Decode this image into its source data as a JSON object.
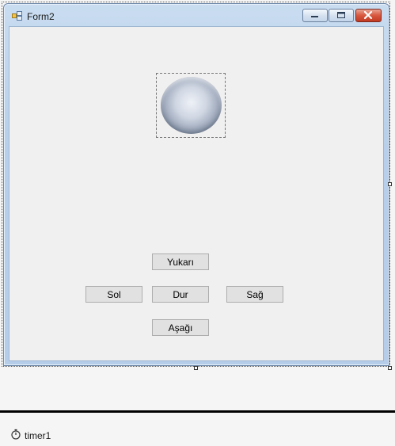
{
  "window": {
    "title": "Form2",
    "controls": {
      "minimize": "minimize-icon",
      "maximize": "maximize-icon",
      "close": "close-icon"
    }
  },
  "picture": {
    "icon": "sphere-image"
  },
  "buttons": {
    "up": "Yukarı",
    "left": "Sol",
    "stop": "Dur",
    "right": "Sağ",
    "down": "Aşağı"
  },
  "component_tray": {
    "items": [
      {
        "label": "timer1",
        "icon": "stopwatch-icon"
      }
    ]
  },
  "colors": {
    "title_bar": "#c9dcf0",
    "client": "#f0f0f0",
    "close_button": "#d8573f",
    "button_face": "#e1e1e1"
  }
}
